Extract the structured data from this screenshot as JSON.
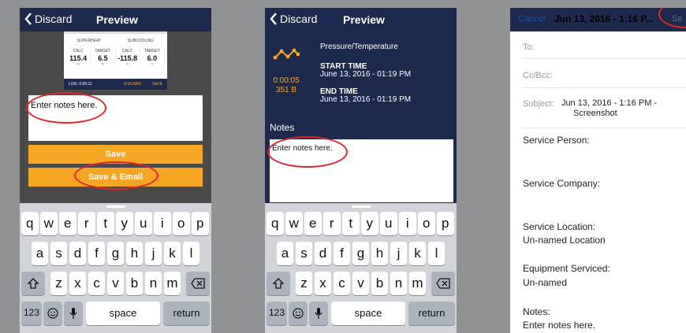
{
  "phone1": {
    "nav": {
      "back": "Discard",
      "title": "Preview"
    },
    "gauge": {
      "superheat_label": "SUPERHEAT",
      "subcooling_label": "SUBCOOLING",
      "cells": [
        {
          "head": "CALC",
          "value": "115.4",
          "unit": "°F"
        },
        {
          "head": "TARGET",
          "value": "6.5",
          "unit": "°F"
        },
        {
          "head": "CALC",
          "value": "-115.8",
          "unit": "°F"
        },
        {
          "head": "TARGET",
          "value": "6.0",
          "unit": "°F"
        }
      ],
      "log": "LOG: 0:00:11",
      "discard": "DISCARD",
      "save": "SAVE"
    },
    "notes_placeholder": "Enter notes here.",
    "save_button": "Save",
    "save_email_button": "Save & Email"
  },
  "phone2": {
    "nav": {
      "back": "Discard",
      "title": "Preview"
    },
    "type": "Pressure/Temperature",
    "duration": "0:00:05",
    "size": "351 B",
    "start_label": "START TIME",
    "start_value": "June 13, 2016 - 01:19 PM",
    "end_label": "END TIME",
    "end_value": "June 13, 2016 - 01:19 PM",
    "notes_label": "Notes",
    "notes_placeholder": "Enter notes here."
  },
  "keyboard": {
    "row1": [
      "q",
      "w",
      "e",
      "r",
      "t",
      "y",
      "u",
      "i",
      "o",
      "p"
    ],
    "row2": [
      "a",
      "s",
      "d",
      "f",
      "g",
      "h",
      "j",
      "k",
      "l"
    ],
    "row3": [
      "z",
      "x",
      "c",
      "v",
      "b",
      "n",
      "m"
    ],
    "numbers": "123",
    "space": "space",
    "return": "return"
  },
  "phone3": {
    "cancel": "Cancel",
    "subject_title": "Jun 13, 2016 - 1:16 P...",
    "send": "Se",
    "to_label": "To:",
    "ccbcc_label": "Cc/Bcc:",
    "subject_label": "Subject:",
    "subject_line1": "Jun 13, 2016 - 1:16 PM -",
    "subject_line2": "Screenshot",
    "service_person": "Service Person:",
    "service_company": "Service Company:",
    "service_location_label": "Service Location:",
    "service_location_value": "Un-named Location",
    "equipment_label": "Equipment Serviced:",
    "equipment_value": "Un-named",
    "notes_label": "Notes:",
    "notes_value": "Enter notes here."
  },
  "colors": {
    "navy": "#1d2a4e",
    "orange": "#f6a623",
    "annotation_red": "#e0242a",
    "background": "#909294"
  }
}
